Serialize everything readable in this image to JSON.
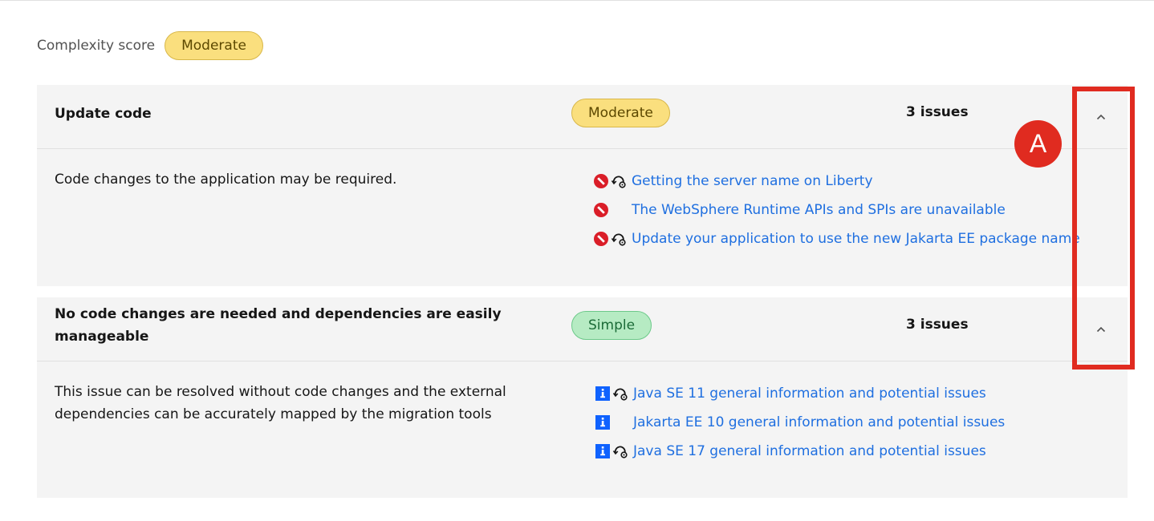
{
  "complexity": {
    "label": "Complexity score",
    "value": "Moderate"
  },
  "sections": [
    {
      "title": "Update code",
      "complexity": "Moderate",
      "issue_count": "3 issues",
      "description": "Code changes to the application may be required.",
      "issues": [
        {
          "severity_icon": "blocked-icon",
          "automated": true,
          "label": "Getting the server name on Liberty"
        },
        {
          "severity_icon": "blocked-icon",
          "automated": false,
          "label": "The WebSphere Runtime APIs and SPIs are unavailable"
        },
        {
          "severity_icon": "blocked-icon",
          "automated": true,
          "label": "Update your application to use the new Jakarta EE package name"
        }
      ]
    },
    {
      "title": "No code changes are needed and dependencies are easily manageable",
      "complexity": "Simple",
      "issue_count": "3 issues",
      "description": "This issue can be resolved without code changes and the external dependencies can be accurately mapped by the migration tools",
      "issues": [
        {
          "severity_icon": "info-icon",
          "automated": true,
          "label": "Java SE 11 general information and potential issues"
        },
        {
          "severity_icon": "info-icon",
          "automated": false,
          "label": "Jakarta EE 10 general information and potential issues"
        },
        {
          "severity_icon": "info-icon",
          "automated": true,
          "label": "Java SE 17 general information and potential issues"
        }
      ]
    }
  ],
  "annotation": {
    "marker": "A"
  },
  "colors": {
    "moderate": "#fadf7e",
    "simple": "#b6ebc3",
    "link": "#1f6fe0",
    "blocked": "#da1e28",
    "info": "#0f62fe",
    "annotation": "#e02b20"
  }
}
